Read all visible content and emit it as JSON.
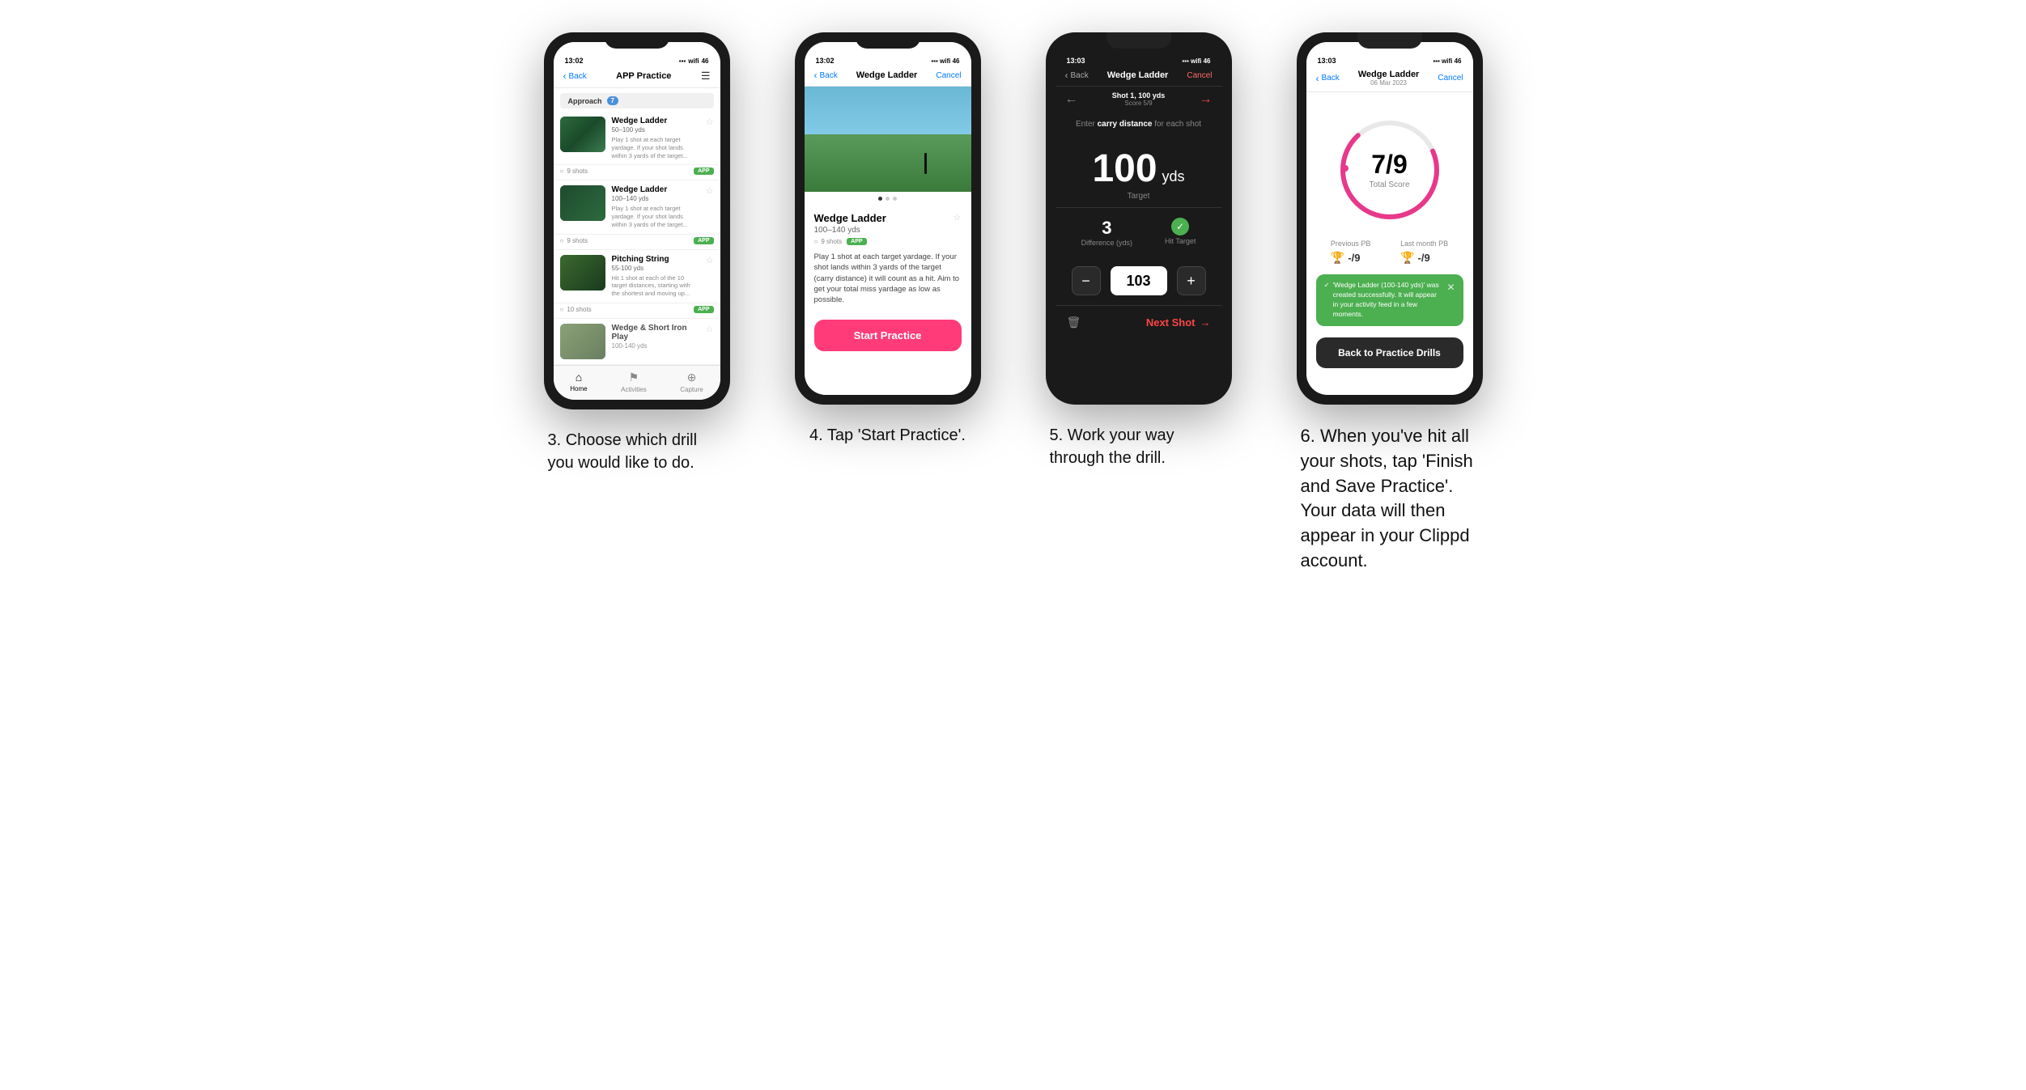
{
  "phone1": {
    "status_time": "13:02",
    "nav_back": "Back",
    "nav_title": "APP Practice",
    "section_label": "Approach",
    "section_count": "7",
    "drills": [
      {
        "name": "Wedge Ladder",
        "yds": "50–100 yds",
        "desc": "Play 1 shot at each target yardage. If your shot lands within 3 yards of the target...",
        "shots": "9 shots",
        "badge": "APP"
      },
      {
        "name": "Wedge Ladder",
        "yds": "100–140 yds",
        "desc": "Play 1 shot at each target yardage. If your shot lands within 3 yards of the target...",
        "shots": "9 shots",
        "badge": "APP"
      },
      {
        "name": "Pitching String",
        "yds": "55-100 yds",
        "desc": "Hit 1 shot at each of the 10 target distances, starting with the shortest and moving up...",
        "shots": "10 shots",
        "badge": "APP"
      },
      {
        "name": "Wedge & Short Iron Play",
        "yds": "100-140 yds",
        "desc": "",
        "shots": "",
        "badge": ""
      }
    ],
    "tabs": [
      "Home",
      "Activities",
      "Capture"
    ],
    "caption": "3. Choose which drill you would like to do."
  },
  "phone2": {
    "status_time": "13:02",
    "nav_back": "Back",
    "nav_title": "Wedge Ladder",
    "nav_cancel": "Cancel",
    "drill_name": "Wedge Ladder",
    "drill_yds": "100–140 yds",
    "shots": "9 shots",
    "badge": "APP",
    "desc": "Play 1 shot at each target yardage. If your shot lands within 3 yards of the target (carry distance) it will count as a hit. Aim to get your total miss yardage as low as possible.",
    "start_btn": "Start Practice",
    "caption": "4. Tap 'Start Practice'."
  },
  "phone3": {
    "status_time": "13:03",
    "nav_back": "Back",
    "nav_title": "Wedge Ladder",
    "nav_cancel": "Cancel",
    "shot_label": "Shot 1, 100 yds",
    "shot_score": "Score 5/9",
    "carry_instruction": "Enter carry distance for each shot",
    "target_yds": "100",
    "target_unit": "yds",
    "target_label": "Target",
    "difference_value": "3",
    "difference_label": "Difference (yds)",
    "hit_target_label": "Hit Target",
    "stepper_value": "103",
    "next_shot": "Next Shot",
    "caption": "5. Work your way through the drill."
  },
  "phone4": {
    "status_time": "13:03",
    "nav_back": "Back",
    "nav_title": "Wedge Ladder",
    "nav_date": "06 Mar 2023",
    "nav_cancel": "Cancel",
    "score_numerator": "7",
    "score_denominator": "9",
    "total_score_label": "Total Score",
    "previous_pb_label": "Previous PB",
    "previous_pb_value": "-/9",
    "last_month_pb_label": "Last month PB",
    "last_month_pb_value": "-/9",
    "toast_msg": "'Wedge Ladder (100-140 yds)' was created successfully. It will appear in your activity feed in a few moments.",
    "back_btn": "Back to Practice Drills",
    "caption": "6. When you've hit all your shots, tap 'Finish and Save Practice'. Your data will then appear in your Clippd account."
  }
}
